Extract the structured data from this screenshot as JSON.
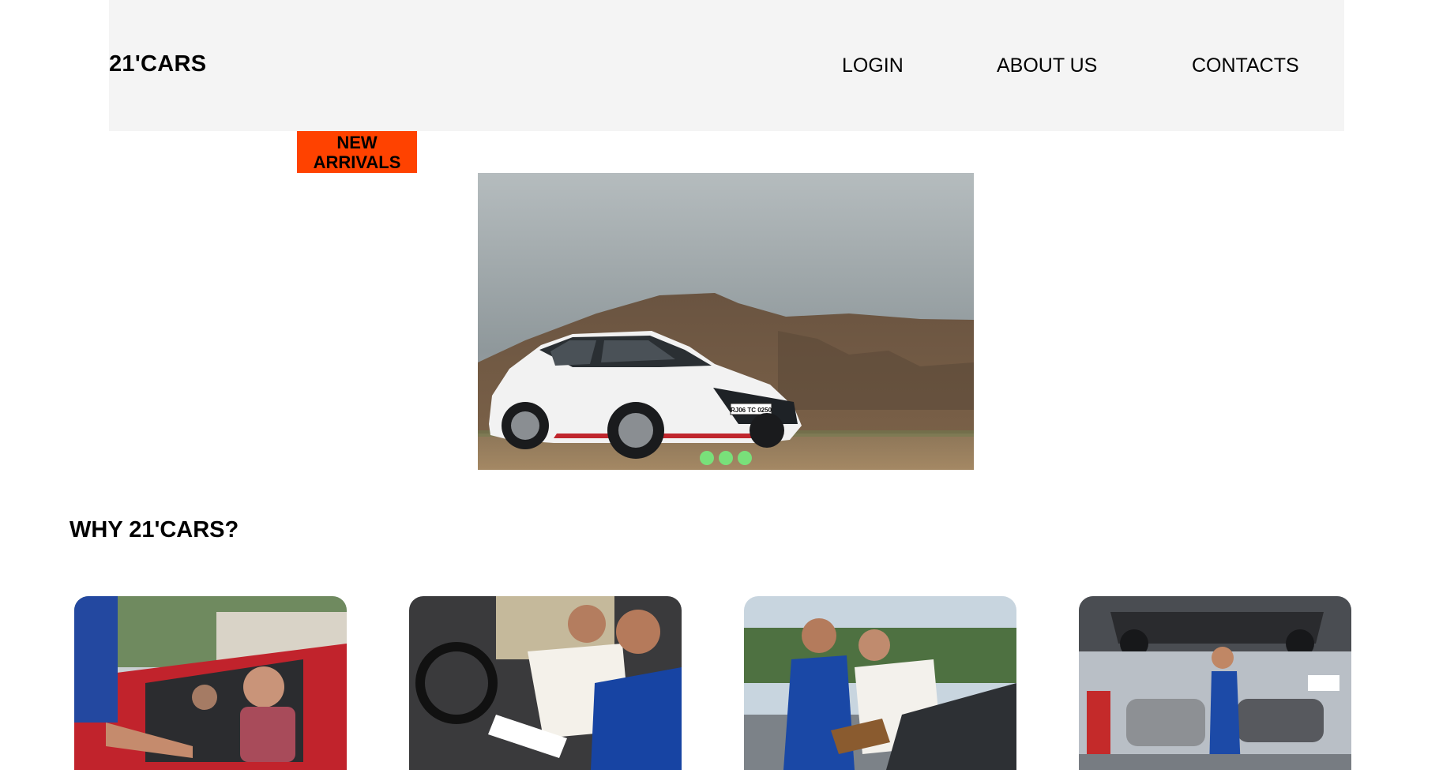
{
  "header": {
    "logo": "21'CARS",
    "nav": {
      "login": "LOGIN",
      "about": "ABOUT US",
      "contacts": "CONTACTS"
    }
  },
  "badge": "NEW\nARRIVALS",
  "carousel": {
    "slide_count": 3,
    "image": "white hatchback parked in front of rocky hill",
    "plate_text": "RJ06 TC 0250",
    "dot_color": "#79e07a"
  },
  "why_section": {
    "title": "WHY 21'CARS?",
    "cards": [
      {
        "image": "handshake with customer in red car"
      },
      {
        "image": "smiling driver with agent reviewing document"
      },
      {
        "image": "agent and customer inspecting car bonnet"
      },
      {
        "image": "mechanic working under lifted car in garage"
      }
    ]
  },
  "colors": {
    "header_bg": "#f4f4f4",
    "badge_bg": "#ff4200",
    "text": "#000000"
  }
}
